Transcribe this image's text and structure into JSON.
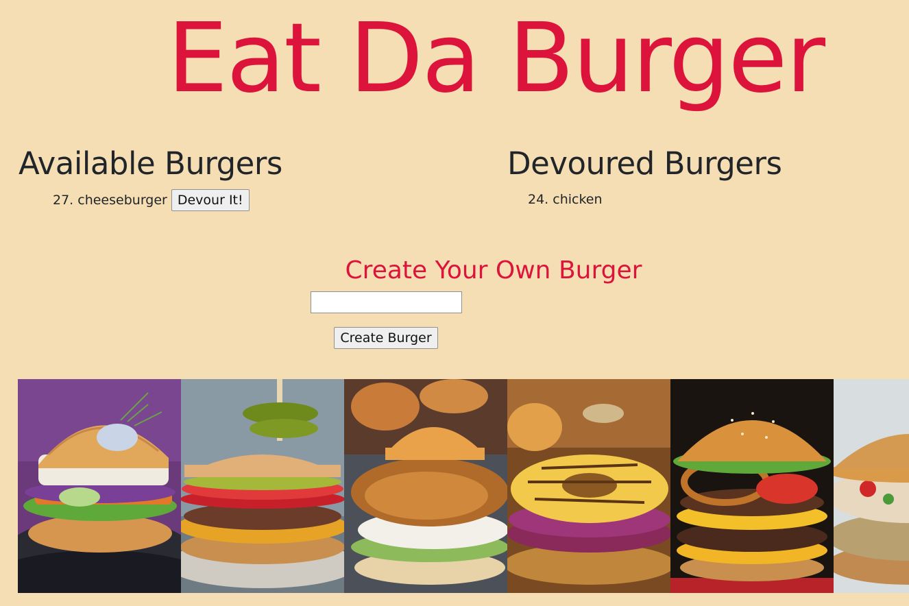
{
  "header": {
    "title": "Eat Da Burger"
  },
  "available": {
    "heading": "Available Burgers",
    "items": [
      {
        "label": "27. cheeseburger",
        "button_label": "Devour It!"
      }
    ]
  },
  "devoured": {
    "heading": "Devoured Burgers",
    "items": [
      {
        "label": "24. chicken"
      }
    ]
  },
  "create": {
    "heading": "Create Your Own Burger",
    "input_value": "",
    "button_label": "Create Burger"
  },
  "gallery": {
    "images": [
      "fish-burger-photo",
      "cheeseburger-pickles-photo",
      "fried-chicken-burger-photo",
      "pineapple-burger-photo",
      "onion-ring-burger-photo",
      "veggie-burger-photo"
    ]
  },
  "colors": {
    "background": "#f5deb3",
    "accent": "#dc143c",
    "text": "#212529"
  }
}
